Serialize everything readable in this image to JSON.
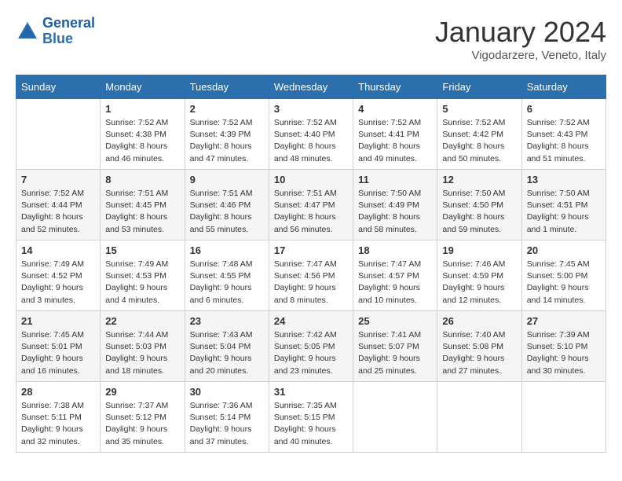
{
  "header": {
    "logo_line1": "General",
    "logo_line2": "Blue",
    "month_year": "January 2024",
    "location": "Vigodarzere, Veneto, Italy"
  },
  "days_of_week": [
    "Sunday",
    "Monday",
    "Tuesday",
    "Wednesday",
    "Thursday",
    "Friday",
    "Saturday"
  ],
  "weeks": [
    [
      {
        "num": "",
        "info": ""
      },
      {
        "num": "1",
        "info": "Sunrise: 7:52 AM\nSunset: 4:38 PM\nDaylight: 8 hours\nand 46 minutes."
      },
      {
        "num": "2",
        "info": "Sunrise: 7:52 AM\nSunset: 4:39 PM\nDaylight: 8 hours\nand 47 minutes."
      },
      {
        "num": "3",
        "info": "Sunrise: 7:52 AM\nSunset: 4:40 PM\nDaylight: 8 hours\nand 48 minutes."
      },
      {
        "num": "4",
        "info": "Sunrise: 7:52 AM\nSunset: 4:41 PM\nDaylight: 8 hours\nand 49 minutes."
      },
      {
        "num": "5",
        "info": "Sunrise: 7:52 AM\nSunset: 4:42 PM\nDaylight: 8 hours\nand 50 minutes."
      },
      {
        "num": "6",
        "info": "Sunrise: 7:52 AM\nSunset: 4:43 PM\nDaylight: 8 hours\nand 51 minutes."
      }
    ],
    [
      {
        "num": "7",
        "info": "Sunrise: 7:52 AM\nSunset: 4:44 PM\nDaylight: 8 hours\nand 52 minutes."
      },
      {
        "num": "8",
        "info": "Sunrise: 7:51 AM\nSunset: 4:45 PM\nDaylight: 8 hours\nand 53 minutes."
      },
      {
        "num": "9",
        "info": "Sunrise: 7:51 AM\nSunset: 4:46 PM\nDaylight: 8 hours\nand 55 minutes."
      },
      {
        "num": "10",
        "info": "Sunrise: 7:51 AM\nSunset: 4:47 PM\nDaylight: 8 hours\nand 56 minutes."
      },
      {
        "num": "11",
        "info": "Sunrise: 7:50 AM\nSunset: 4:49 PM\nDaylight: 8 hours\nand 58 minutes."
      },
      {
        "num": "12",
        "info": "Sunrise: 7:50 AM\nSunset: 4:50 PM\nDaylight: 8 hours\nand 59 minutes."
      },
      {
        "num": "13",
        "info": "Sunrise: 7:50 AM\nSunset: 4:51 PM\nDaylight: 9 hours\nand 1 minute."
      }
    ],
    [
      {
        "num": "14",
        "info": "Sunrise: 7:49 AM\nSunset: 4:52 PM\nDaylight: 9 hours\nand 3 minutes."
      },
      {
        "num": "15",
        "info": "Sunrise: 7:49 AM\nSunset: 4:53 PM\nDaylight: 9 hours\nand 4 minutes."
      },
      {
        "num": "16",
        "info": "Sunrise: 7:48 AM\nSunset: 4:55 PM\nDaylight: 9 hours\nand 6 minutes."
      },
      {
        "num": "17",
        "info": "Sunrise: 7:47 AM\nSunset: 4:56 PM\nDaylight: 9 hours\nand 8 minutes."
      },
      {
        "num": "18",
        "info": "Sunrise: 7:47 AM\nSunset: 4:57 PM\nDaylight: 9 hours\nand 10 minutes."
      },
      {
        "num": "19",
        "info": "Sunrise: 7:46 AM\nSunset: 4:59 PM\nDaylight: 9 hours\nand 12 minutes."
      },
      {
        "num": "20",
        "info": "Sunrise: 7:45 AM\nSunset: 5:00 PM\nDaylight: 9 hours\nand 14 minutes."
      }
    ],
    [
      {
        "num": "21",
        "info": "Sunrise: 7:45 AM\nSunset: 5:01 PM\nDaylight: 9 hours\nand 16 minutes."
      },
      {
        "num": "22",
        "info": "Sunrise: 7:44 AM\nSunset: 5:03 PM\nDaylight: 9 hours\nand 18 minutes."
      },
      {
        "num": "23",
        "info": "Sunrise: 7:43 AM\nSunset: 5:04 PM\nDaylight: 9 hours\nand 20 minutes."
      },
      {
        "num": "24",
        "info": "Sunrise: 7:42 AM\nSunset: 5:05 PM\nDaylight: 9 hours\nand 23 minutes."
      },
      {
        "num": "25",
        "info": "Sunrise: 7:41 AM\nSunset: 5:07 PM\nDaylight: 9 hours\nand 25 minutes."
      },
      {
        "num": "26",
        "info": "Sunrise: 7:40 AM\nSunset: 5:08 PM\nDaylight: 9 hours\nand 27 minutes."
      },
      {
        "num": "27",
        "info": "Sunrise: 7:39 AM\nSunset: 5:10 PM\nDaylight: 9 hours\nand 30 minutes."
      }
    ],
    [
      {
        "num": "28",
        "info": "Sunrise: 7:38 AM\nSunset: 5:11 PM\nDaylight: 9 hours\nand 32 minutes."
      },
      {
        "num": "29",
        "info": "Sunrise: 7:37 AM\nSunset: 5:12 PM\nDaylight: 9 hours\nand 35 minutes."
      },
      {
        "num": "30",
        "info": "Sunrise: 7:36 AM\nSunset: 5:14 PM\nDaylight: 9 hours\nand 37 minutes."
      },
      {
        "num": "31",
        "info": "Sunrise: 7:35 AM\nSunset: 5:15 PM\nDaylight: 9 hours\nand 40 minutes."
      },
      {
        "num": "",
        "info": ""
      },
      {
        "num": "",
        "info": ""
      },
      {
        "num": "",
        "info": ""
      }
    ]
  ]
}
